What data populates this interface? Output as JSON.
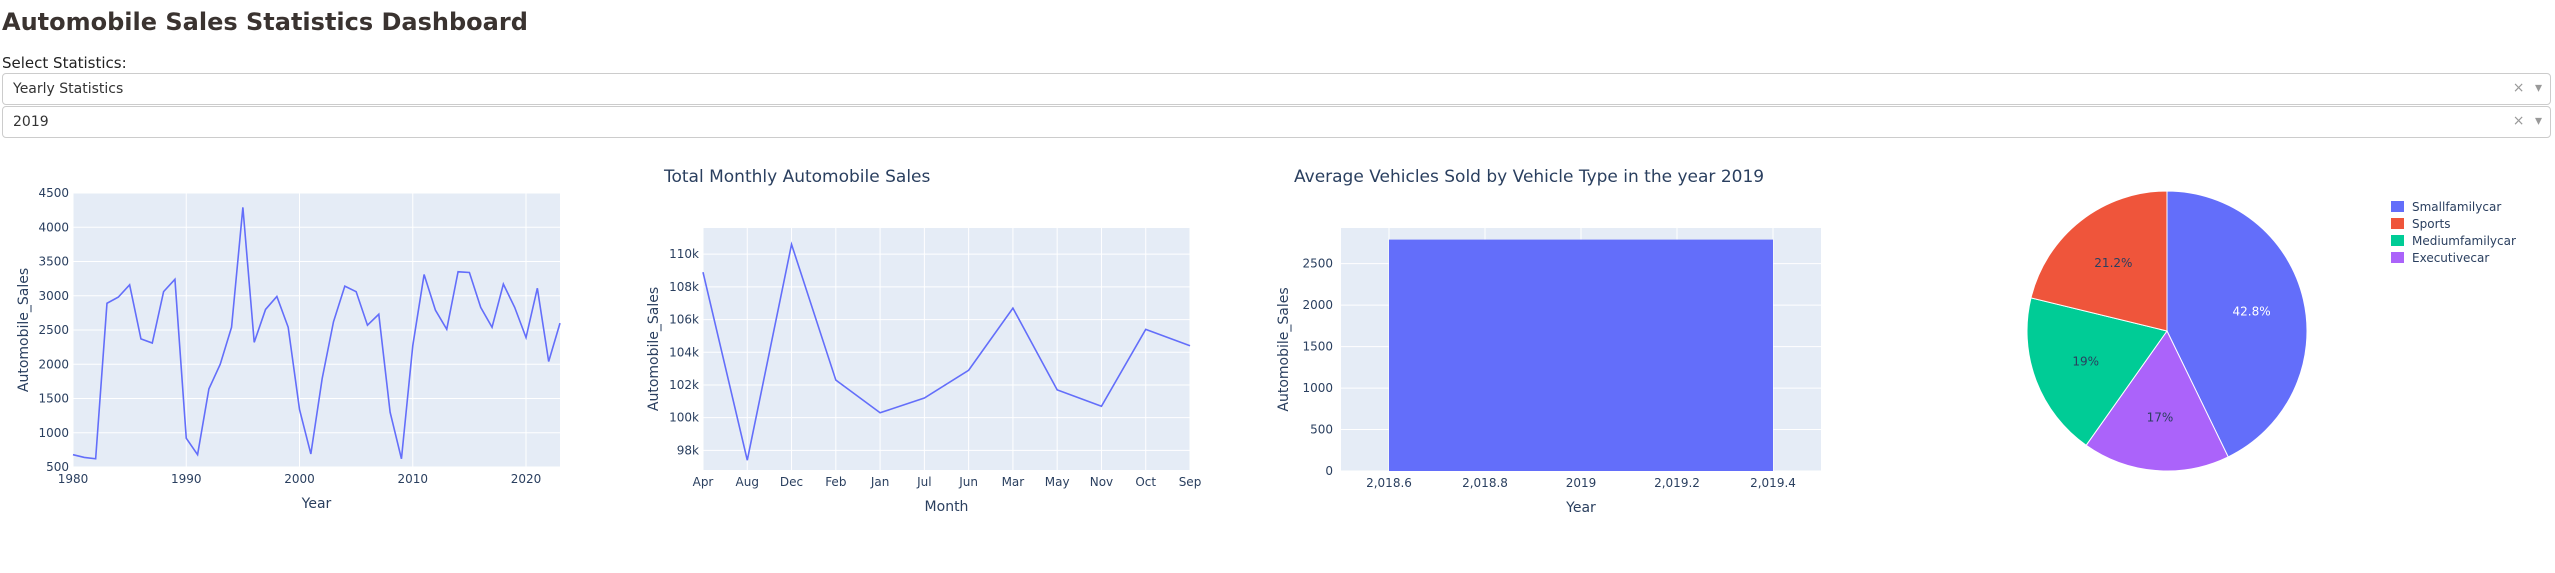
{
  "page": {
    "title": "Automobile Sales Statistics Dashboard",
    "select_label": "Select Statistics:",
    "dropdowns": [
      {
        "value": "Yearly Statistics",
        "clear": "×",
        "arrow": "▾"
      },
      {
        "value": "2019",
        "clear": "×",
        "arrow": "▾"
      }
    ]
  },
  "chart_data": [
    {
      "type": "line",
      "title": "",
      "xlabel": "Year",
      "ylabel": "Automobile_Sales",
      "x": [
        1980,
        1981,
        1982,
        1983,
        1984,
        1985,
        1986,
        1987,
        1988,
        1989,
        1990,
        1991,
        1992,
        1993,
        1994,
        1995,
        1996,
        1997,
        1998,
        1999,
        2000,
        2001,
        2002,
        2003,
        2004,
        2005,
        2006,
        2007,
        2008,
        2009,
        2010,
        2011,
        2012,
        2013,
        2014,
        2015,
        2016,
        2017,
        2018,
        2019,
        2020,
        2021,
        2022,
        2023
      ],
      "values": [
        680,
        640,
        620,
        2890,
        2980,
        3160,
        2370,
        2310,
        3060,
        3240,
        920,
        680,
        1640,
        2000,
        2540,
        4290,
        2320,
        2800,
        2990,
        2540,
        1340,
        690,
        1790,
        2620,
        3140,
        3060,
        2570,
        2730,
        1300,
        620,
        2270,
        3310,
        2790,
        2510,
        3350,
        3340,
        2830,
        2540,
        3170,
        2830,
        2390,
        3110,
        2040,
        2600
      ],
      "xlim": [
        1980,
        2023
      ],
      "ylim": [
        500,
        4500
      ],
      "xticks": [
        "1980",
        "1990",
        "2000",
        "2010",
        "2020"
      ],
      "yticks": [
        "500",
        "1000",
        "1500",
        "2000",
        "2500",
        "3000",
        "3500",
        "4000",
        "4500"
      ],
      "color": "#636efa",
      "grid": true
    },
    {
      "type": "line",
      "title": "Total Monthly Automobile Sales",
      "xlabel": "Month",
      "ylabel": "Automobile_Sales",
      "categories": [
        "Apr",
        "Aug",
        "Dec",
        "Feb",
        "Jan",
        "Jul",
        "Jun",
        "Mar",
        "May",
        "Nov",
        "Oct",
        "Sep"
      ],
      "values": [
        108900,
        97400,
        110600,
        102300,
        100300,
        101200,
        102900,
        106700,
        101700,
        100700,
        105400,
        104400
      ],
      "ylim": [
        96800,
        111600
      ],
      "yticks": [
        "98k",
        "100k",
        "102k",
        "104k",
        "106k",
        "108k",
        "110k"
      ],
      "ytick_values": [
        98000,
        100000,
        102000,
        104000,
        106000,
        108000,
        110000
      ],
      "color": "#636efa",
      "grid": true
    },
    {
      "type": "bar",
      "title": "Average Vehicles Sold by Vehicle Type in the year 2019",
      "xlabel": "Year",
      "ylabel": "Automobile_Sales",
      "x": [
        2019
      ],
      "values": [
        2790
      ],
      "bar_width_data": 0.8,
      "xlim": [
        2018.5,
        2019.5
      ],
      "ylim": [
        0,
        2930
      ],
      "xticks": [
        "2,018.6",
        "2,018.8",
        "2019",
        "2,019.2",
        "2,019.4"
      ],
      "xtick_values": [
        2018.6,
        2018.8,
        2019,
        2019.2,
        2019.4
      ],
      "yticks": [
        "0",
        "500",
        "1000",
        "1500",
        "2000",
        "2500"
      ],
      "ytick_values": [
        0,
        500,
        1000,
        1500,
        2000,
        2500
      ],
      "color": "#636efa",
      "grid": true
    },
    {
      "type": "pie",
      "title": "",
      "slices": [
        {
          "label": "Smallfamilycar",
          "value": 42.8,
          "text": "42.8%",
          "color": "#636efa"
        },
        {
          "label": "Executivecar",
          "value": 17.0,
          "text": "17%",
          "color": "#ab63fa"
        },
        {
          "label": "Mediumfamilycar",
          "value": 19.0,
          "text": "19%",
          "color": "#00cc96"
        },
        {
          "label": "Sports",
          "value": 21.2,
          "text": "21.2%",
          "color": "#ef553b"
        }
      ],
      "legend": [
        "Smallfamilycar",
        "Sports",
        "Mediumfamilycar",
        "Executivecar"
      ],
      "legend_position": "top-right"
    }
  ]
}
